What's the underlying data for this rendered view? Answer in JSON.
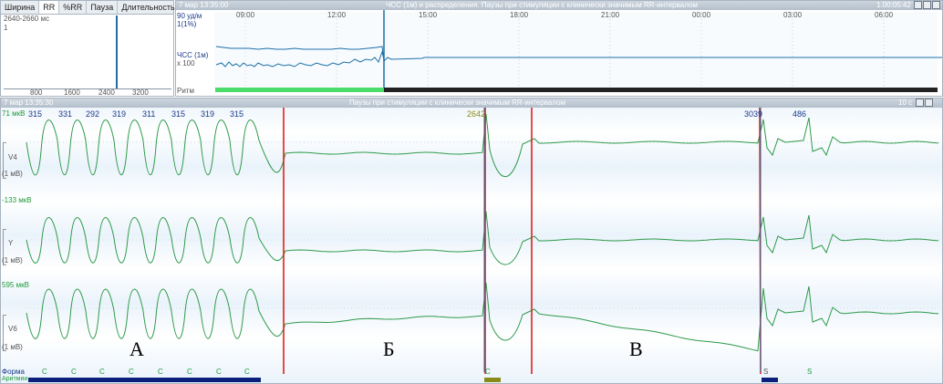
{
  "histogram": {
    "tabs": [
      "Ширина",
      "RR",
      "%RR",
      "Пауза",
      "Длительность"
    ],
    "active_tab": "RR",
    "range_label": "2640-2660 мс",
    "count": "1",
    "x_ticks": [
      "800",
      "1600",
      "2400",
      "3200"
    ]
  },
  "trend": {
    "date": "7 мар 13:35:00",
    "title": "ЧСС (1м) и распределения. Паузы при стимуляции с клинически значимым RR-интервалом",
    "duration": "1.00:05:42",
    "time_ticks": [
      "09:00",
      "12:00",
      "15:00",
      "18:00",
      "21:00",
      "00:00",
      "03:00",
      "06:00"
    ],
    "y_top": "90 уд/м",
    "y_count": "1(1%)",
    "hr_label": "ЧСС (1м)",
    "scale": "x 100",
    "rhythm_label": "Ритм"
  },
  "ecg": {
    "date": "7 мар 13:35:30",
    "title": "Паузы при стимуляции с клинически значимым RR-интервалом",
    "speed": "10 с",
    "rr_values": [
      "315",
      "331",
      "292",
      "319",
      "311",
      "315",
      "319",
      "315"
    ],
    "pause1": "2642",
    "pause2": "3039",
    "after_rr": "486",
    "leads": [
      {
        "name": "V4",
        "offset": "71 мкВ",
        "scale": "(1 мВ)"
      },
      {
        "name": "Y",
        "offset": "-133 мкВ",
        "scale": "(1 мВ)"
      },
      {
        "name": "V6",
        "offset": "595 мкВ",
        "scale": "(1 мВ)"
      }
    ],
    "segments": [
      "А",
      "Б",
      "В"
    ],
    "form_label": "Форма",
    "arrhythmia_label": "Аритмии",
    "beat_forms_a": [
      "C",
      "C",
      "C",
      "C",
      "C",
      "C",
      "C",
      "C"
    ],
    "beat_form_c": "C",
    "beat_form_s1": "S",
    "beat_form_s2": "S",
    "colors": {
      "trace": "#2e9a4a",
      "marker": "#e0201a",
      "pace": "#1e6fa8",
      "bar_blue": "#0c1f7a",
      "bar_olive": "#8a8a1a"
    }
  }
}
